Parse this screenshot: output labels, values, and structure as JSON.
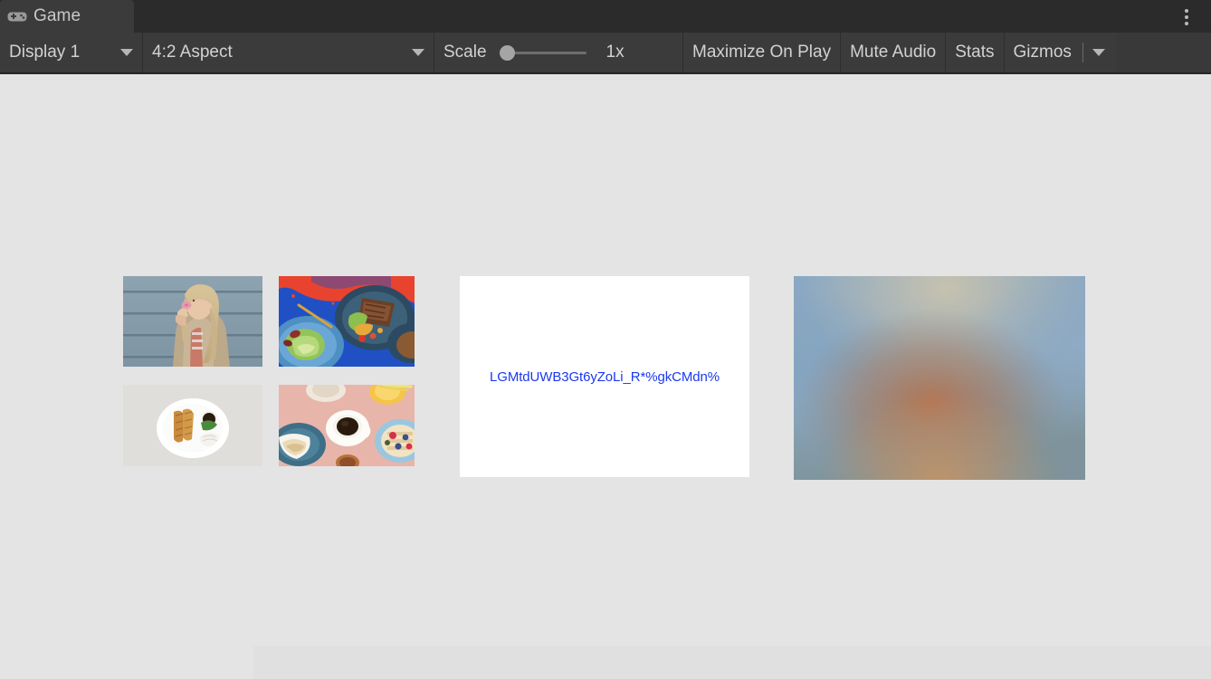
{
  "window": {
    "tab_label": "Game",
    "tab_icon": "gamepad-icon",
    "overflow_menu_icon": "kebab-menu-icon"
  },
  "toolbar": {
    "display_label": "Display 1",
    "display_caret_icon": "chevron-down-icon",
    "aspect_label": "4:2 Aspect",
    "aspect_caret_icon": "chevron-down-icon",
    "scale_label": "Scale",
    "scale_value": "1x",
    "scale_slider_position_pct": 0,
    "maximize_on_play_label": "Maximize On Play",
    "mute_audio_label": "Mute Audio",
    "stats_label": "Stats",
    "gizmos_label": "Gizmos",
    "gizmos_caret_icon": "chevron-down-icon"
  },
  "game_view": {
    "background_color": "#e4e4e4",
    "thumbnails": [
      {
        "name": "woman-eating-donut-photo",
        "alt": "Woman in tan coat eating a pink frosted donut in front of grey wooden wall"
      },
      {
        "name": "steak-salad-plate-photo",
        "alt": "Overhead shot of grilled steak and salad on dark plates over red and blue painted background"
      },
      {
        "name": "fried-food-white-plate-photo",
        "alt": "Overhead shot of fried food with dipping sauce and rice on a white plate"
      },
      {
        "name": "breakfast-table-photo",
        "alt": "Overhead breakfast spread with coffee, orange juice and berry waffles on pink table"
      }
    ],
    "content_panel": {
      "link_text": "LGMtdUWB3Gt6yZoLi_R*%gkCMdn%",
      "link_color": "#1a39f0",
      "background_color": "#ffffff"
    },
    "blurred_image": {
      "name": "blurred-placeholder-image",
      "alt": "Heavily blurred image with blue-grey surroundings and warm brown centre"
    }
  }
}
